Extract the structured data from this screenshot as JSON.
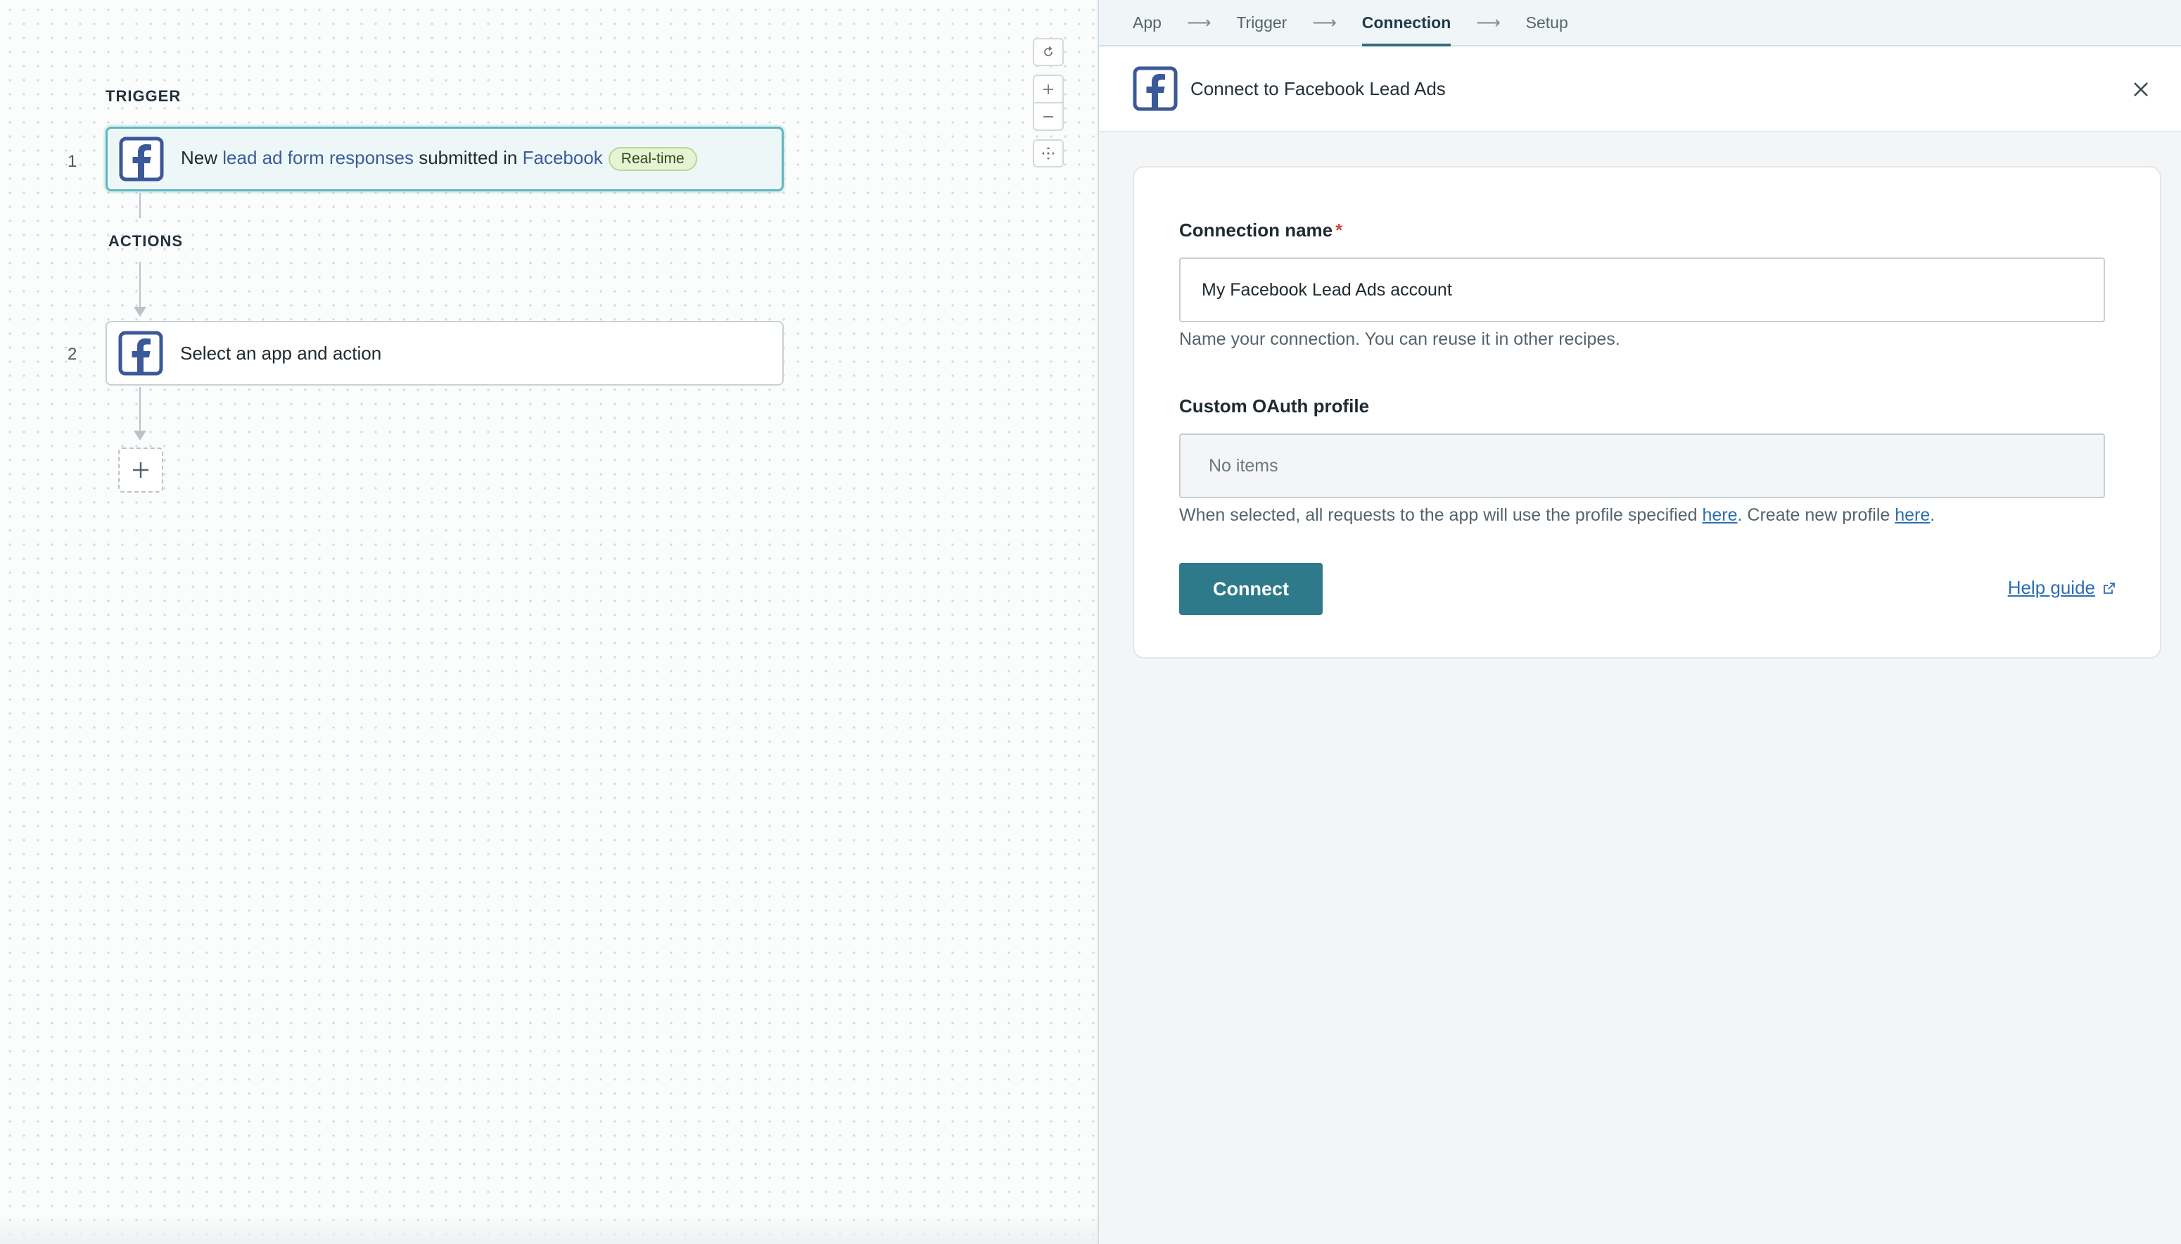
{
  "canvas": {
    "trigger_label": "TRIGGER",
    "actions_label": "ACTIONS",
    "steps": [
      {
        "number": "1",
        "icon": "facebook-icon",
        "parts": {
          "prefix": "New ",
          "object": "lead ad form responses",
          "middle": " submitted in ",
          "app": "Facebook"
        },
        "badge": "Real-time"
      },
      {
        "number": "2",
        "icon": "facebook-icon",
        "text": "Select an app and action"
      }
    ],
    "zoom_controls": [
      "reset-icon",
      "zoom-in-icon",
      "zoom-out-icon",
      "fit-view-icon"
    ]
  },
  "panel": {
    "breadcrumb": [
      {
        "label": "App"
      },
      {
        "label": "Trigger"
      },
      {
        "label": "Connection",
        "active": true
      },
      {
        "label": "Setup"
      }
    ],
    "header": {
      "icon": "facebook-icon",
      "title": "Connect to Facebook Lead Ads"
    },
    "form": {
      "connection_name_label": "Connection name",
      "required_mark": "*",
      "connection_name_value": "My Facebook Lead Ads account",
      "connection_name_hint": "Name your connection. You can reuse it in other recipes.",
      "oauth_label": "Custom OAuth profile",
      "oauth_value": "No items",
      "oauth_hint_1": "When selected, all requests to the app will use the profile specified ",
      "oauth_hint_link_1": "here",
      "oauth_hint_2": ". Create new profile ",
      "oauth_hint_link_2": "here",
      "oauth_hint_3": ".",
      "connect_label": "Connect",
      "help_label": "Help guide"
    }
  },
  "colors": {
    "accent_teal": "#2f7a8a",
    "link_blue": "#2c6fb0",
    "facebook_blue": "#3b5998",
    "active_border": "#5fb7c0",
    "badge_green_bg": "#e6f4d4"
  }
}
